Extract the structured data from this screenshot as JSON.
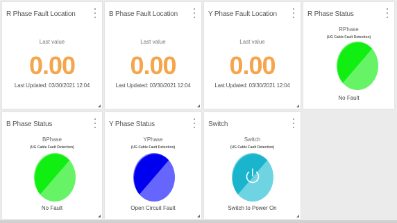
{
  "metric_tiles": [
    {
      "title": "R Phase Fault Location",
      "label": "Last value",
      "value": "0.00",
      "updated": "Last Updated: 03/30/2021 12:04"
    },
    {
      "title": "B Phase Fault Location",
      "label": "Last value",
      "value": "0.00",
      "updated": "Last Updated: 03/30/2021 12:04"
    },
    {
      "title": "Y Phase Fault Location",
      "label": "Last value",
      "value": "0.00",
      "updated": "Last Updated: 03/30/2021 12:04"
    }
  ],
  "status_tiles": [
    {
      "title": "R Phase Status",
      "name": "RPhase",
      "sub": "(UG Cable Fault Detection)",
      "status": "No Fault",
      "color_dark": "#11ee11",
      "color_light": "#66f466"
    },
    {
      "title": "B Phase Status",
      "name": "BPhase",
      "sub": "(UG Cable Fault Detection)",
      "status": "No Fault",
      "color_dark": "#11ee11",
      "color_light": "#66f466"
    },
    {
      "title": "Y Phase Status",
      "name": "YPhase",
      "sub": "(UG Cable Fault Detection)",
      "status": "Open Circuit Fault",
      "color_dark": "#0000ee",
      "color_light": "#6666ff"
    },
    {
      "title": "Switch",
      "name": "Switch",
      "sub": "(UG Cable Fault Detection)",
      "status": "Switch to Power On",
      "color_dark": "#1ab4cc",
      "color_light": "#6ed4e2",
      "icon": "power-icon"
    }
  ]
}
